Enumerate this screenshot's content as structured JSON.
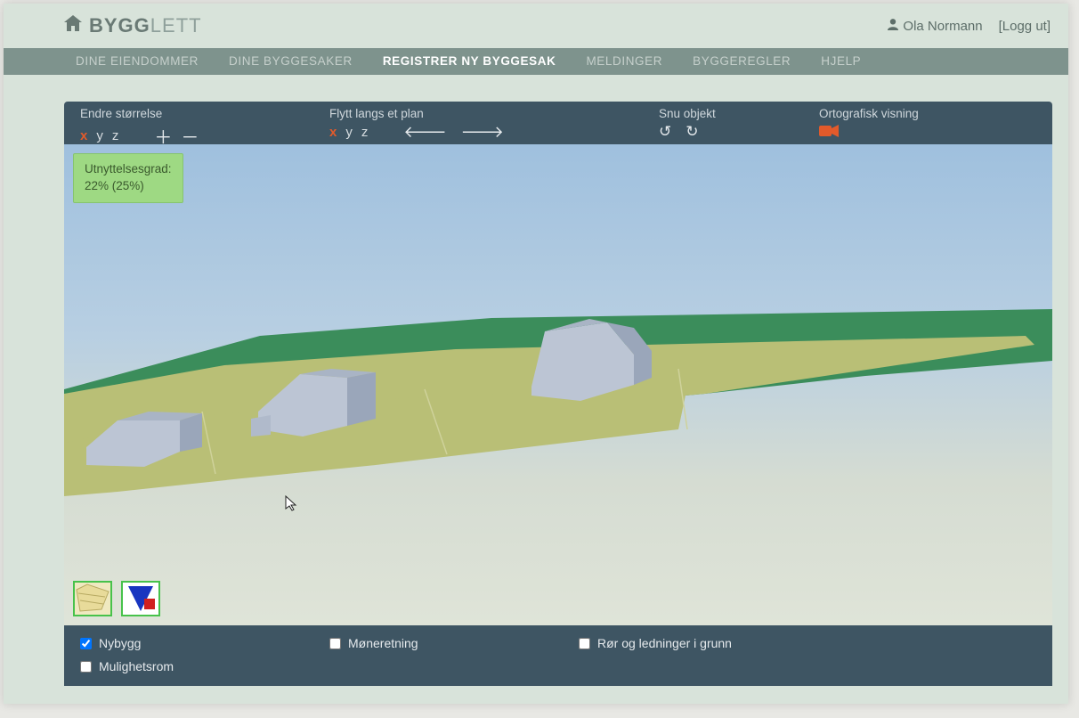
{
  "brand": {
    "part1": "BYGG",
    "part2": "LETT"
  },
  "user": {
    "name": "Ola Normann",
    "logout": "[Logg ut]"
  },
  "nav": {
    "items": [
      "DINE EIENDOMMER",
      "DINE BYGGESAKER",
      "REGISTRER NY BYGGESAK",
      "MELDINGER",
      "BYGGEREGLER",
      "HJELP"
    ],
    "active_index": 2
  },
  "toolbar": {
    "size": {
      "label": "Endre størrelse",
      "axes": [
        "x",
        "y",
        "z"
      ],
      "plus": "＋",
      "minus": "－"
    },
    "move": {
      "label": "Flytt langs et plan",
      "axes": [
        "x",
        "y",
        "z"
      ],
      "left": "🡐",
      "right": "🡒"
    },
    "rotate": {
      "label": "Snu objekt",
      "ccw": "↺",
      "cw": "↻"
    },
    "view": {
      "label": "Ortografisk visning",
      "icon": "📹"
    }
  },
  "badge": {
    "line1": "Utnyttelsesgrad:",
    "line2": "22% (25%)"
  },
  "options": {
    "nybygg": {
      "label": "Nybygg",
      "checked": true
    },
    "moneretning": {
      "label": "Møneretning",
      "checked": false
    },
    "ror": {
      "label": "Rør og ledninger i grunn",
      "checked": false
    },
    "mulighetsrom": {
      "label": "Mulighetsrom",
      "checked": false
    }
  }
}
